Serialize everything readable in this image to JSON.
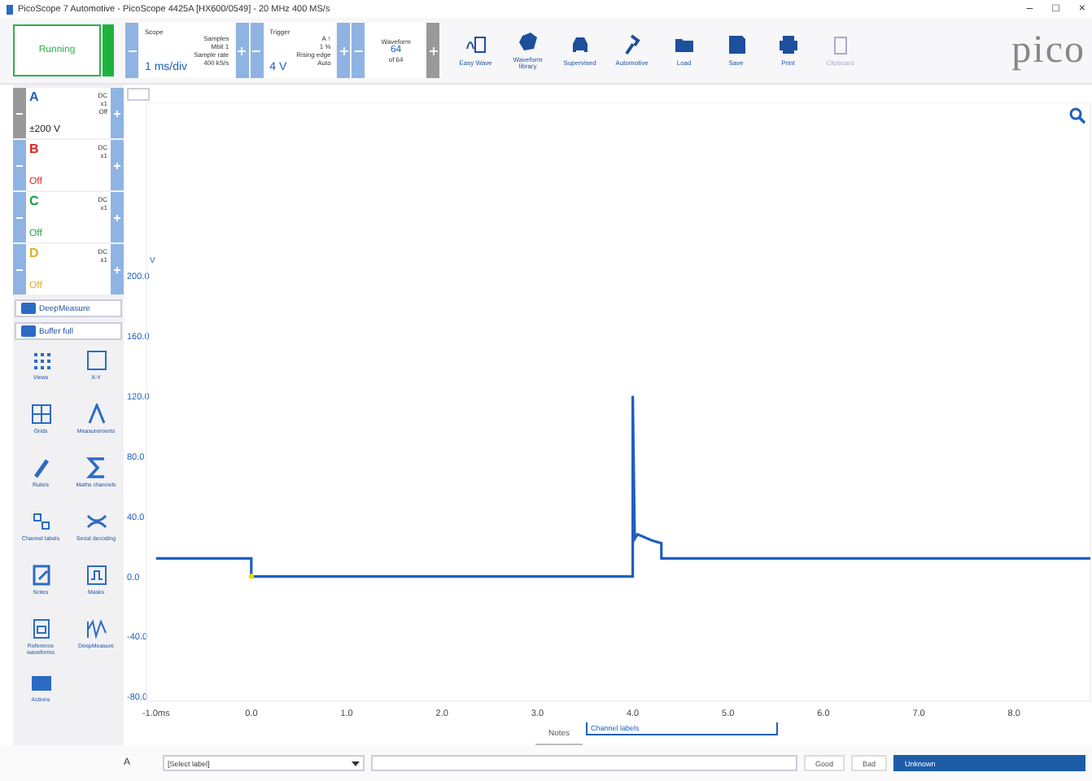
{
  "window": {
    "title": "PicoScope 7 Automotive - PicoScope 4425A [HX600/0549] - 20 MHz 400 MS/s",
    "controls": [
      "–",
      "□",
      "×"
    ]
  },
  "toolbar": {
    "run": {
      "label": "Running",
      "on": true
    },
    "scope": {
      "label": "Scope",
      "value": "1 ms/div",
      "details": [
        "Samples",
        "Mbit 1",
        "Sample rate",
        "400 kS/s"
      ]
    },
    "trigger": {
      "label": "Trigger",
      "value": "4 V",
      "details": [
        "A  ↑",
        "1 %",
        "Rising edge",
        "Auto"
      ]
    },
    "waveforms": {
      "label": "Waveform",
      "value": "64",
      "sub": "of 64"
    },
    "buttons": [
      {
        "label": "Easy Wave",
        "disabled": false
      },
      {
        "label": "Waveform library",
        "disabled": false
      },
      {
        "label": "Supervised",
        "disabled": false
      },
      {
        "label": "Automotive",
        "disabled": false
      },
      {
        "label": "Load",
        "disabled": false
      },
      {
        "label": "Save",
        "disabled": false
      },
      {
        "label": "Print",
        "disabled": false
      },
      {
        "label": "Clipboard",
        "disabled": true
      }
    ],
    "logo": "pico"
  },
  "channels": [
    {
      "name": "A",
      "range": "±200 V",
      "coupling": [
        "DC",
        "x1",
        "Off"
      ],
      "enabled": true,
      "color": "#1f5fbf"
    },
    {
      "name": "B",
      "range": "Off",
      "coupling": [
        "DC",
        "x1"
      ],
      "enabled": false,
      "color": "#e02020"
    },
    {
      "name": "C",
      "range": "Off",
      "coupling": [
        "DC",
        "x1"
      ],
      "enabled": false,
      "color": "#20a040"
    },
    {
      "name": "D",
      "range": "Off",
      "coupling": [
        "DC",
        "x1"
      ],
      "enabled": false,
      "color": "#e0b020"
    }
  ],
  "side_buttons": [
    "DeepMeasure",
    "Buffer full"
  ],
  "tools": [
    {
      "label": "Views"
    },
    {
      "label": "X-Y"
    },
    {
      "label": "Grids"
    },
    {
      "label": "Measurements"
    },
    {
      "label": "Rulers"
    },
    {
      "label": "Maths channels"
    },
    {
      "label": "Channel labels"
    },
    {
      "label": "Serial decoding"
    },
    {
      "label": "Notes"
    },
    {
      "label": "Masks"
    },
    {
      "label": "Reference waveforms"
    },
    {
      "label": "DeepMeasure"
    },
    {
      "label": "Actions"
    }
  ],
  "plot": {
    "chart_data": {
      "type": "line",
      "ylabel": "V",
      "xlim": [
        -1.1,
        8.8
      ],
      "ylim": [
        -83,
        315
      ],
      "xticks": [
        {
          "value": -1,
          "label": "-1.0ms"
        },
        {
          "value": 0,
          "label": "0.0"
        },
        {
          "value": 1,
          "label": "1.0"
        },
        {
          "value": 2,
          "label": "2.0"
        },
        {
          "value": 3,
          "label": "3.0"
        },
        {
          "value": 4,
          "label": "4.0"
        },
        {
          "value": 5,
          "label": "5.0"
        },
        {
          "value": 6,
          "label": "6.0"
        },
        {
          "value": 7,
          "label": "7.0"
        },
        {
          "value": 8,
          "label": "8.0"
        }
      ],
      "yticks": [
        {
          "value": 200,
          "label": "200.0"
        },
        {
          "value": 160,
          "label": "160.0"
        },
        {
          "value": 120,
          "label": "120.0"
        },
        {
          "value": 80,
          "label": "80.0"
        },
        {
          "value": 40,
          "label": "40.0"
        },
        {
          "value": 0,
          "label": "0.0"
        },
        {
          "value": -40,
          "label": "-40.0"
        },
        {
          "value": -80,
          "label": "-80.0"
        }
      ],
      "x": [
        -1.0,
        0.0,
        0.0,
        4.0,
        4.0,
        4.02,
        4.05,
        4.2,
        4.3,
        4.3,
        8.8
      ],
      "series": [
        {
          "color": "#1f5fbf",
          "values": [
            12,
            12,
            0,
            0,
            120,
            25,
            28,
            24,
            22,
            12,
            12
          ]
        }
      ]
    }
  },
  "bottom_tabs": [
    {
      "label": "Notes",
      "selected": false
    },
    {
      "label": "Channel labels",
      "selected": true
    }
  ],
  "note_bar": {
    "channel": "A",
    "label_select": "[Select label]",
    "buttons": [
      {
        "label": "Good",
        "selected": false
      },
      {
        "label": "Bad",
        "selected": false
      },
      {
        "label": "Unknown",
        "selected": true
      }
    ]
  }
}
